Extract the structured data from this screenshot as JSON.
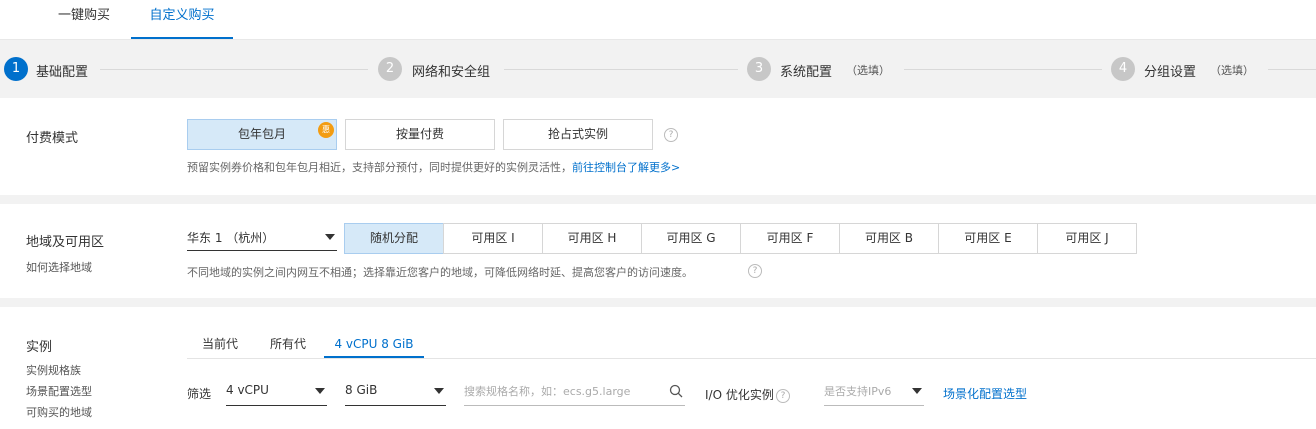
{
  "top_tabs": [
    {
      "label": "一键购买",
      "active": false
    },
    {
      "label": "自定义购买",
      "active": true
    }
  ],
  "steps": [
    {
      "number": "1",
      "label": "基础配置",
      "optional": "",
      "active": true
    },
    {
      "number": "2",
      "label": "网络和安全组",
      "optional": "",
      "active": false
    },
    {
      "number": "3",
      "label": "系统配置",
      "optional": "（选填）",
      "active": false
    },
    {
      "number": "4",
      "label": "分组设置",
      "optional": "（选填）",
      "active": false
    }
  ],
  "billing": {
    "title": "付费模式",
    "options": [
      "包年包月",
      "按量付费",
      "抢占式实例"
    ],
    "selected": "包年包月",
    "badge": "惠",
    "hint": "预留实例券价格和包年包月相近，支持部分预付，同时提供更好的实例灵活性，",
    "hint_link": "前往控制台了解更多>"
  },
  "region": {
    "title": "地域及可用区",
    "subtitle": "如何选择地域",
    "selected_region": "华东 1 （杭州）",
    "zones": [
      "随机分配",
      "可用区 I",
      "可用区 H",
      "可用区 G",
      "可用区 F",
      "可用区 B",
      "可用区 E",
      "可用区 J"
    ],
    "selected_zone": "随机分配",
    "hint": "不同地域的实例之间内网互不相通；选择靠近您客户的地域，可降低网络时延、提高您客户的访问速度。"
  },
  "instance": {
    "title": "实例",
    "side_links": [
      "实例规格族",
      "场景配置选型",
      "可购买的地域"
    ],
    "tabs": [
      "当前代",
      "所有代",
      "4 vCPU 8 GiB"
    ],
    "active_tab": "4 vCPU 8 GiB",
    "filter_label": "筛选",
    "vcpu": "4 vCPU",
    "memory": "8 GiB",
    "search_placeholder": "搜索规格名称，如：ecs.g5.large",
    "io_label": "I/O 优化实例",
    "ipv6_placeholder": "是否支持IPv6",
    "scene_link": "场景化配置选型"
  },
  "colors": {
    "accent": "#0070cc",
    "selected_bg": "#d6e9f8",
    "badge": "#f39c12",
    "page_bg": "#f2f2f2"
  }
}
